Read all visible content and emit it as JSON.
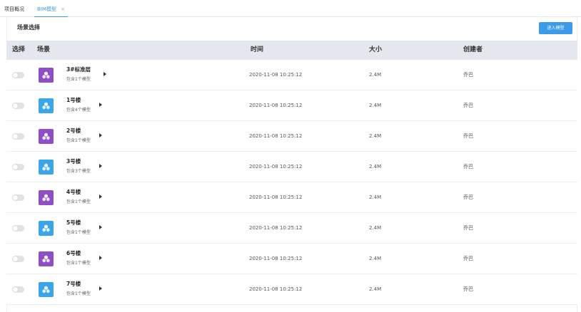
{
  "tabs": [
    {
      "label": "项目概况",
      "active": false
    },
    {
      "label": "BIM模型",
      "active": true,
      "close": "×"
    }
  ],
  "section": {
    "title": "场景选择"
  },
  "toolbar": {
    "enter_label": "进入模型"
  },
  "table": {
    "headers": {
      "select": "选择",
      "scene": "场景",
      "time": "时间",
      "size": "大小",
      "creator": "创建者"
    },
    "rows": [
      {
        "name": "3#标准层",
        "sub": "包含1个模型",
        "time": "2020-11-08 10:25:12",
        "size": "2.4M",
        "creator": "乔巴",
        "icon_color": "#8e4fc6"
      },
      {
        "name": "1号楼",
        "sub": "包含4个模型",
        "time": "2020-11-08 10:25:12",
        "size": "2.4M",
        "creator": "乔巴",
        "icon_color": "#3aa6ea"
      },
      {
        "name": "2号楼",
        "sub": "包含1个模型",
        "time": "2020-11-08 10:25:12",
        "size": "2.4M",
        "creator": "乔巴",
        "icon_color": "#8e4fc6"
      },
      {
        "name": "3号楼",
        "sub": "包含3个模型",
        "time": "2020-11-08 10:25:12",
        "size": "2.4M",
        "creator": "乔巴",
        "icon_color": "#3aa6ea"
      },
      {
        "name": "4号楼",
        "sub": "包含1个模型",
        "time": "2020-11-08 10:25:12",
        "size": "2.4M",
        "creator": "乔巴",
        "icon_color": "#8e4fc6"
      },
      {
        "name": "5号楼",
        "sub": "包含1个模型",
        "time": "2020-11-08 10:25:12",
        "size": "2.4M",
        "creator": "乔巴",
        "icon_color": "#3aa6ea"
      },
      {
        "name": "6号楼",
        "sub": "包含1个模型",
        "time": "2020-11-08 10:25:12",
        "size": "2.4M",
        "creator": "乔巴",
        "icon_color": "#8e4fc6"
      },
      {
        "name": "7号楼",
        "sub": "包含1个模型",
        "time": "2020-11-08 10:25:12",
        "size": "2.4M",
        "creator": "乔巴",
        "icon_color": "#3aa6ea"
      }
    ]
  },
  "colors": {
    "accent": "#3c9be8",
    "header_bg": "#e4e7ee"
  },
  "icons": {
    "row_icon": "model-cube-icon",
    "expand": "caret-right-icon",
    "close": "close-icon"
  }
}
